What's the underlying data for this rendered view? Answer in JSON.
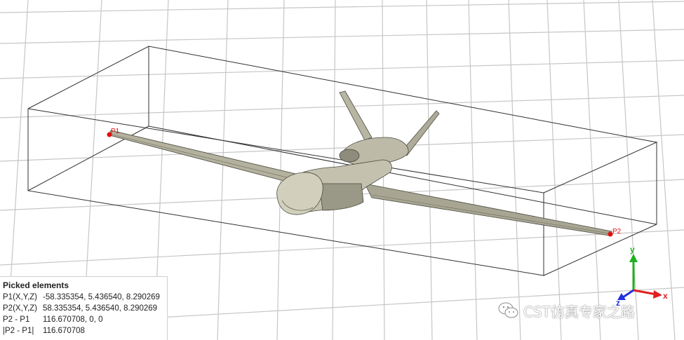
{
  "scene": {
    "point_p1_label": "P1",
    "point_p2_label": "P2",
    "point_color": "#e01010",
    "model_color": "#a6a491",
    "grid_color": "#c6c6c6",
    "bounding_box_color": "#303030"
  },
  "axes": {
    "x_label": "x",
    "y_label": "y",
    "z_label": "z",
    "x_color": "#e02020",
    "y_color": "#20b020",
    "z_color": "#2030e0"
  },
  "picked": {
    "title": "Picked elements",
    "rows": [
      {
        "key": "P1(X,Y,Z)",
        "value": "-58.335354, 5.436540, 8.290269"
      },
      {
        "key": "P2(X,Y,Z)",
        "value": "58.335354, 5.436540, 8.290269"
      },
      {
        "key": "P2 - P1",
        "value": "116.670708, 0, 0"
      },
      {
        "key": "|P2 - P1|",
        "value": "116.670708"
      }
    ]
  },
  "watermark": {
    "icon": "wechat-icon",
    "text": "CST仿真专家之路"
  }
}
